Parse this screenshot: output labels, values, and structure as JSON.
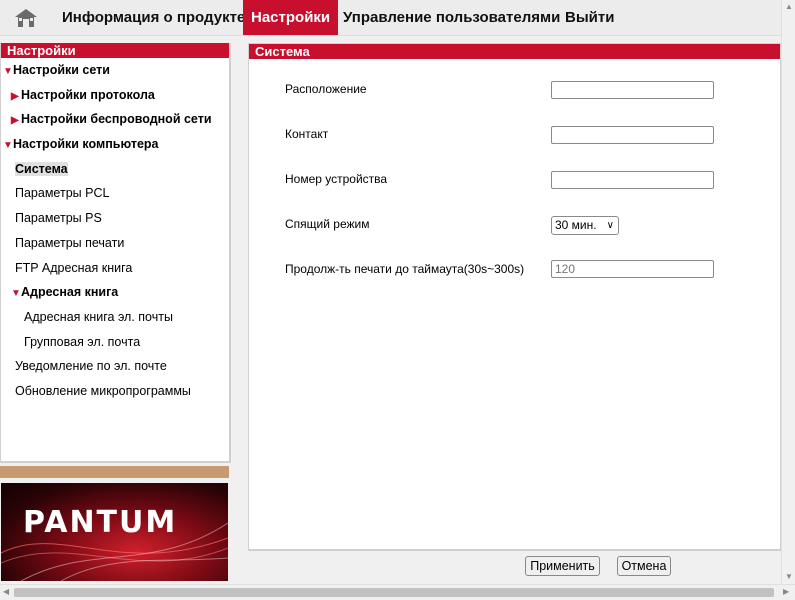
{
  "topnav": {
    "home_icon": "home-icon",
    "items": [
      {
        "label": "Информация о продукте",
        "active": false
      },
      {
        "label": "Настройки",
        "active": true
      },
      {
        "label": "Управление пользователями",
        "active": false
      },
      {
        "label": "Выйти",
        "active": false
      }
    ]
  },
  "sidebar": {
    "title": "Настройки",
    "items": [
      {
        "label": "Настройки сети"
      },
      {
        "label": "Настройки протокола"
      },
      {
        "label": "Настройки беспроводной сети"
      },
      {
        "label": "Настройки компьютера"
      },
      {
        "label": "Система"
      },
      {
        "label": "Параметры PCL"
      },
      {
        "label": "Параметры PS"
      },
      {
        "label": "Параметры печати"
      },
      {
        "label": "FTP Адресная книга"
      },
      {
        "label": "Адресная книга"
      },
      {
        "label": "Адресная книга эл. почты"
      },
      {
        "label": "Групповая эл. почта"
      },
      {
        "label": "Уведомление по эл. почте"
      },
      {
        "label": "Обновление микропрограммы"
      }
    ]
  },
  "logo": {
    "text": "PANTUM"
  },
  "main": {
    "title": "Система",
    "fields": {
      "location": {
        "label": "Расположение",
        "value": ""
      },
      "contact": {
        "label": "Контакт",
        "value": ""
      },
      "device_number": {
        "label": "Номер устройства",
        "value": ""
      },
      "sleep_mode": {
        "label": "Спящий режим",
        "value": "30 мин."
      },
      "print_timeout": {
        "label": "Продолж-ть печати до таймаута(30s~300s)",
        "placeholder": "120"
      }
    },
    "apply_label": "Применить",
    "cancel_label": "Отмена"
  },
  "colors": {
    "accent": "#c8102e",
    "tan": "#c89a70"
  }
}
